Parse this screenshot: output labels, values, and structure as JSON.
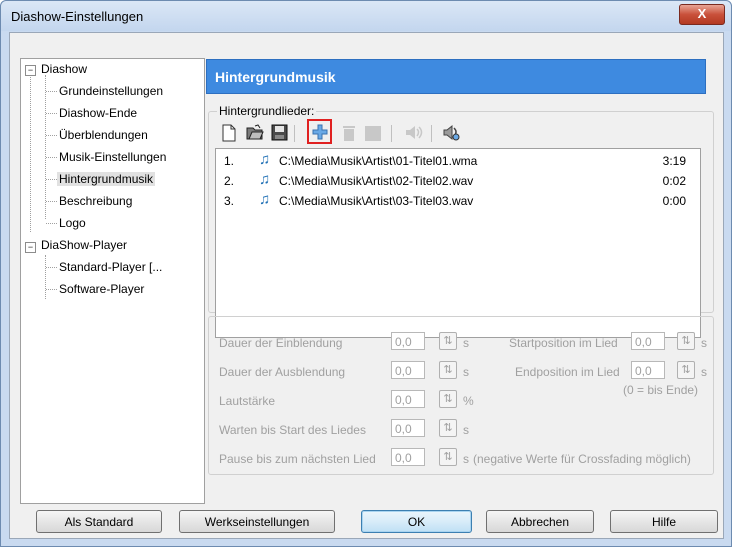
{
  "window": {
    "title": "Diashow-Einstellungen",
    "close_label": "X"
  },
  "tree": {
    "items": [
      {
        "label": "Diashow",
        "expander": "−"
      },
      {
        "label": "Grundeinstellungen"
      },
      {
        "label": "Diashow-Ende"
      },
      {
        "label": "Überblendungen"
      },
      {
        "label": "Musik-Einstellungen"
      },
      {
        "label": "Hintergrundmusik",
        "selected": true
      },
      {
        "label": "Beschreibung"
      },
      {
        "label": "Logo"
      },
      {
        "label": "DiaShow-Player",
        "expander": "−"
      },
      {
        "label": "Standard-Player [..."
      },
      {
        "label": "Software-Player"
      }
    ]
  },
  "panel": {
    "header": "Hintergrundmusik",
    "list_label": "Hintergrundlieder:",
    "toolbar_icons": [
      "new-icon",
      "open-folder-icon",
      "save-icon",
      "add-icon",
      "delete-icon",
      "stop-icon",
      "play-icon",
      "settings-icon"
    ],
    "songs": [
      {
        "num": "1.",
        "path": "C:\\Media\\Musik\\Artist\\01-Titel01.wma",
        "duration": "3:19"
      },
      {
        "num": "2.",
        "path": "C:\\Media\\Musik\\Artist\\02-Titel02.wav",
        "duration": "0:02"
      },
      {
        "num": "3.",
        "path": "C:\\Media\\Musik\\Artist\\03-Titel03.wav",
        "duration": "0:00"
      }
    ]
  },
  "settings": {
    "einblendung": {
      "label": "Dauer der Einblendung",
      "value": "0,0",
      "unit": "s"
    },
    "ausblendung": {
      "label": "Dauer der Ausblendung",
      "value": "0,0",
      "unit": "s"
    },
    "lautstaerke": {
      "label": "Lautstärke",
      "value": "0,0",
      "unit": "%"
    },
    "warten": {
      "label": "Warten bis Start des Liedes",
      "value": "0,0",
      "unit": "s"
    },
    "pause": {
      "label": "Pause bis zum nächsten Lied",
      "value": "0,0",
      "unit": "s",
      "note": "(negative Werte für Crossfading möglich)"
    },
    "startpos": {
      "label": "Startposition im Lied",
      "value": "0,0",
      "unit": "s"
    },
    "endpos": {
      "label": "Endposition im Lied",
      "value": "0,0",
      "unit": "s",
      "note": "(0 = bis Ende)"
    }
  },
  "buttons": {
    "als_standard": "Als Standard",
    "werkseinstellungen": "Werkseinstellungen",
    "ok": "OK",
    "abbrechen": "Abbrechen",
    "hilfe": "Hilfe"
  },
  "colors": {
    "header_bg": "#3e8ae0",
    "accent_red": "#e02020",
    "note_blue": "#1e6fb5"
  }
}
